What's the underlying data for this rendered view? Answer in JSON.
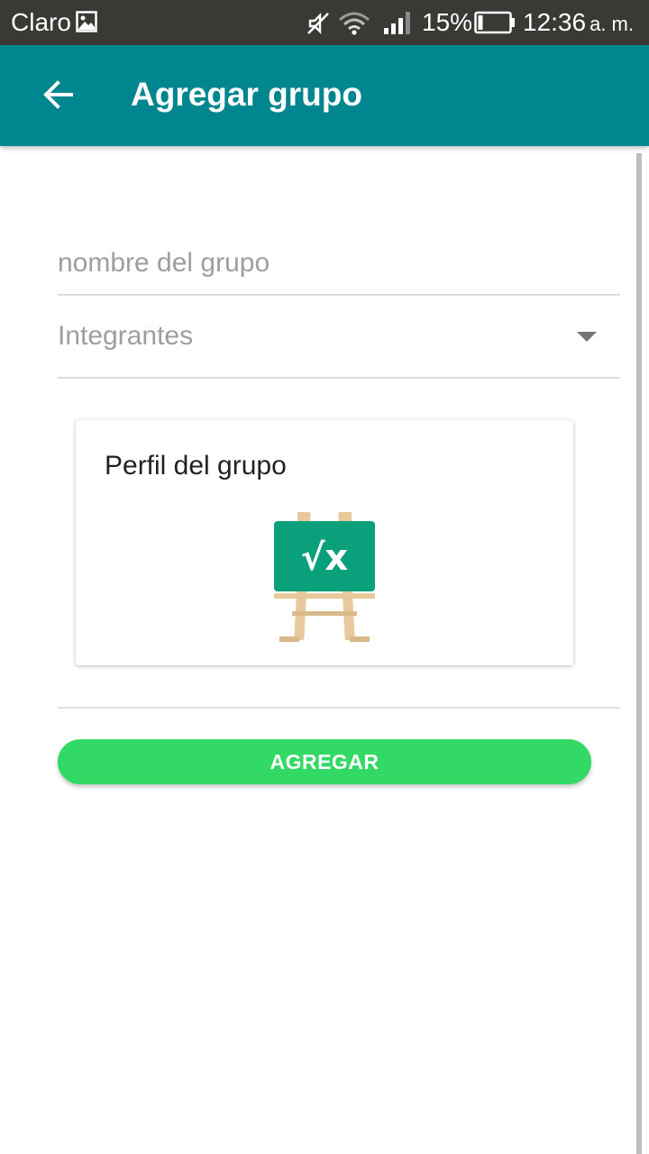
{
  "status_bar": {
    "carrier": "Claro",
    "battery_percent": "15%",
    "time": "12:36",
    "ampm": "a. m.",
    "icons": [
      "image-icon",
      "mute-icon",
      "wifi-icon",
      "signal-icon",
      "battery-icon"
    ]
  },
  "app_bar": {
    "title": "Agregar grupo",
    "back_icon": "arrow-left-icon",
    "color": "#00868f"
  },
  "form": {
    "name_placeholder": "nombre del grupo",
    "name_value": "",
    "members_label": "Integrantes"
  },
  "profile_card": {
    "title": "Perfil del grupo",
    "avatar_icon": "math-easel-icon",
    "avatar_text": "√x"
  },
  "actions": {
    "add_label": "AGREGAR",
    "add_color": "#32d965"
  }
}
